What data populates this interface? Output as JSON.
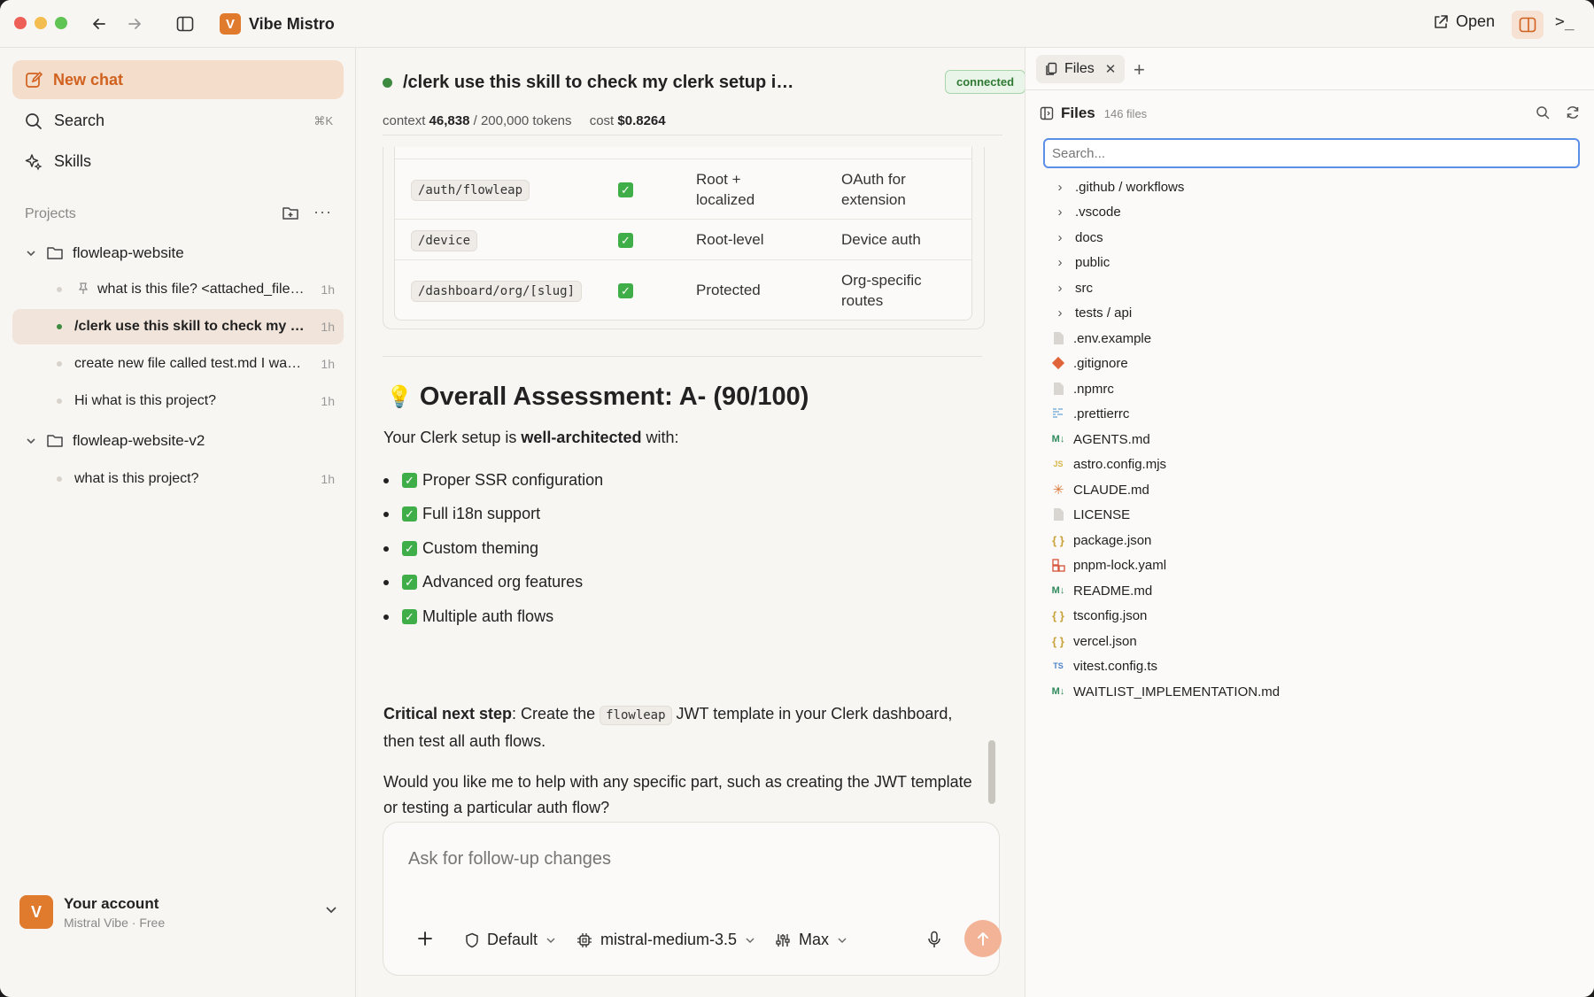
{
  "titlebar": {
    "app_name": "Vibe Mistro",
    "app_logo_letter": "V",
    "open_label": "Open"
  },
  "sidebar": {
    "new_chat": "New chat",
    "search": "Search",
    "search_shortcut": "⌘K",
    "skills": "Skills",
    "projects_label": "Projects",
    "projects": [
      {
        "name": "flowleap-website",
        "chats": [
          {
            "title": "what is this file? <attached_file…",
            "time": "1h",
            "pinned": true
          },
          {
            "title": "/clerk use this skill to check my …",
            "time": "1h",
            "active": true
          },
          {
            "title": "create new file called test.md I wa…",
            "time": "1h"
          },
          {
            "title": "Hi what is this project?",
            "time": "1h"
          }
        ]
      },
      {
        "name": "flowleap-website-v2",
        "chats": [
          {
            "title": "what is this project?",
            "time": "1h"
          }
        ]
      }
    ],
    "account": {
      "initial": "V",
      "name": "Your account",
      "plan": "Mistral Vibe · Free"
    }
  },
  "chat": {
    "title": "/clerk use this skill to check my clerk setup in t…",
    "status": "connected",
    "context_label": "context",
    "context_used": "46,838",
    "context_total": "/ 200,000 tokens",
    "cost_label": "cost",
    "cost_value": "$0.8264",
    "table_rows": [
      {
        "route": "/auth/flowleap",
        "protected": "✓",
        "type": "Root + localized",
        "purpose": "OAuth for extension"
      },
      {
        "route": "/device",
        "protected": "✓",
        "type": "Root-level",
        "purpose": "Device auth"
      },
      {
        "route": "/dashboard/org/[slug]",
        "protected": "✓",
        "type": "Protected",
        "purpose": "Org-specific routes"
      }
    ],
    "heading_emoji": "💡",
    "heading": "Overall Assessment: A- (90/100)",
    "intro_before": "Your Clerk setup is ",
    "intro_bold": "well-architected",
    "intro_after": " with:",
    "bullets": [
      "Proper SSR configuration",
      "Full i18n support",
      "Custom theming",
      "Advanced org features",
      "Multiple auth flows"
    ],
    "next_bold": "Critical next step",
    "next_before": ": Create the ",
    "next_code": "flowleap",
    "next_after": " JWT template in your Clerk dashboard, then test all auth flows.",
    "closing": "Would you like me to help with any specific part, such as creating the JWT template or testing a particular auth flow?"
  },
  "composer": {
    "placeholder": "Ask for follow-up changes",
    "mode": "Default",
    "model": "mistral-medium-3.5",
    "effort": "Max"
  },
  "files_panel": {
    "tab_label": "Files",
    "title": "Files",
    "count": "146 files",
    "search_placeholder": "Search...",
    "folders": [
      ".github / workflows",
      ".vscode",
      "docs",
      "public",
      "src",
      "tests / api"
    ],
    "files": [
      {
        "name": ".env.example",
        "icon": "file-icon"
      },
      {
        "name": ".gitignore",
        "icon": "git-icon"
      },
      {
        "name": ".npmrc",
        "icon": "file-icon"
      },
      {
        "name": ".prettierrc",
        "icon": "prettier-icon"
      },
      {
        "name": "AGENTS.md",
        "icon": "markdown-icon"
      },
      {
        "name": "astro.config.mjs",
        "icon": "js-icon"
      },
      {
        "name": "CLAUDE.md",
        "icon": "claude-icon"
      },
      {
        "name": "LICENSE",
        "icon": "file-icon"
      },
      {
        "name": "package.json",
        "icon": "json-icon"
      },
      {
        "name": "pnpm-lock.yaml",
        "icon": "pnpm-icon"
      },
      {
        "name": "README.md",
        "icon": "markdown-icon"
      },
      {
        "name": "tsconfig.json",
        "icon": "json-icon"
      },
      {
        "name": "vercel.json",
        "icon": "json-icon"
      },
      {
        "name": "vitest.config.ts",
        "icon": "ts-icon"
      },
      {
        "name": "WAITLIST_IMPLEMENTATION.md",
        "icon": "markdown-icon"
      }
    ]
  },
  "colors": {
    "accent": "#e07a2c",
    "connected_green": "#2e7a32",
    "check_green": "#3fae49",
    "focus_blue": "#5b8fe8"
  }
}
